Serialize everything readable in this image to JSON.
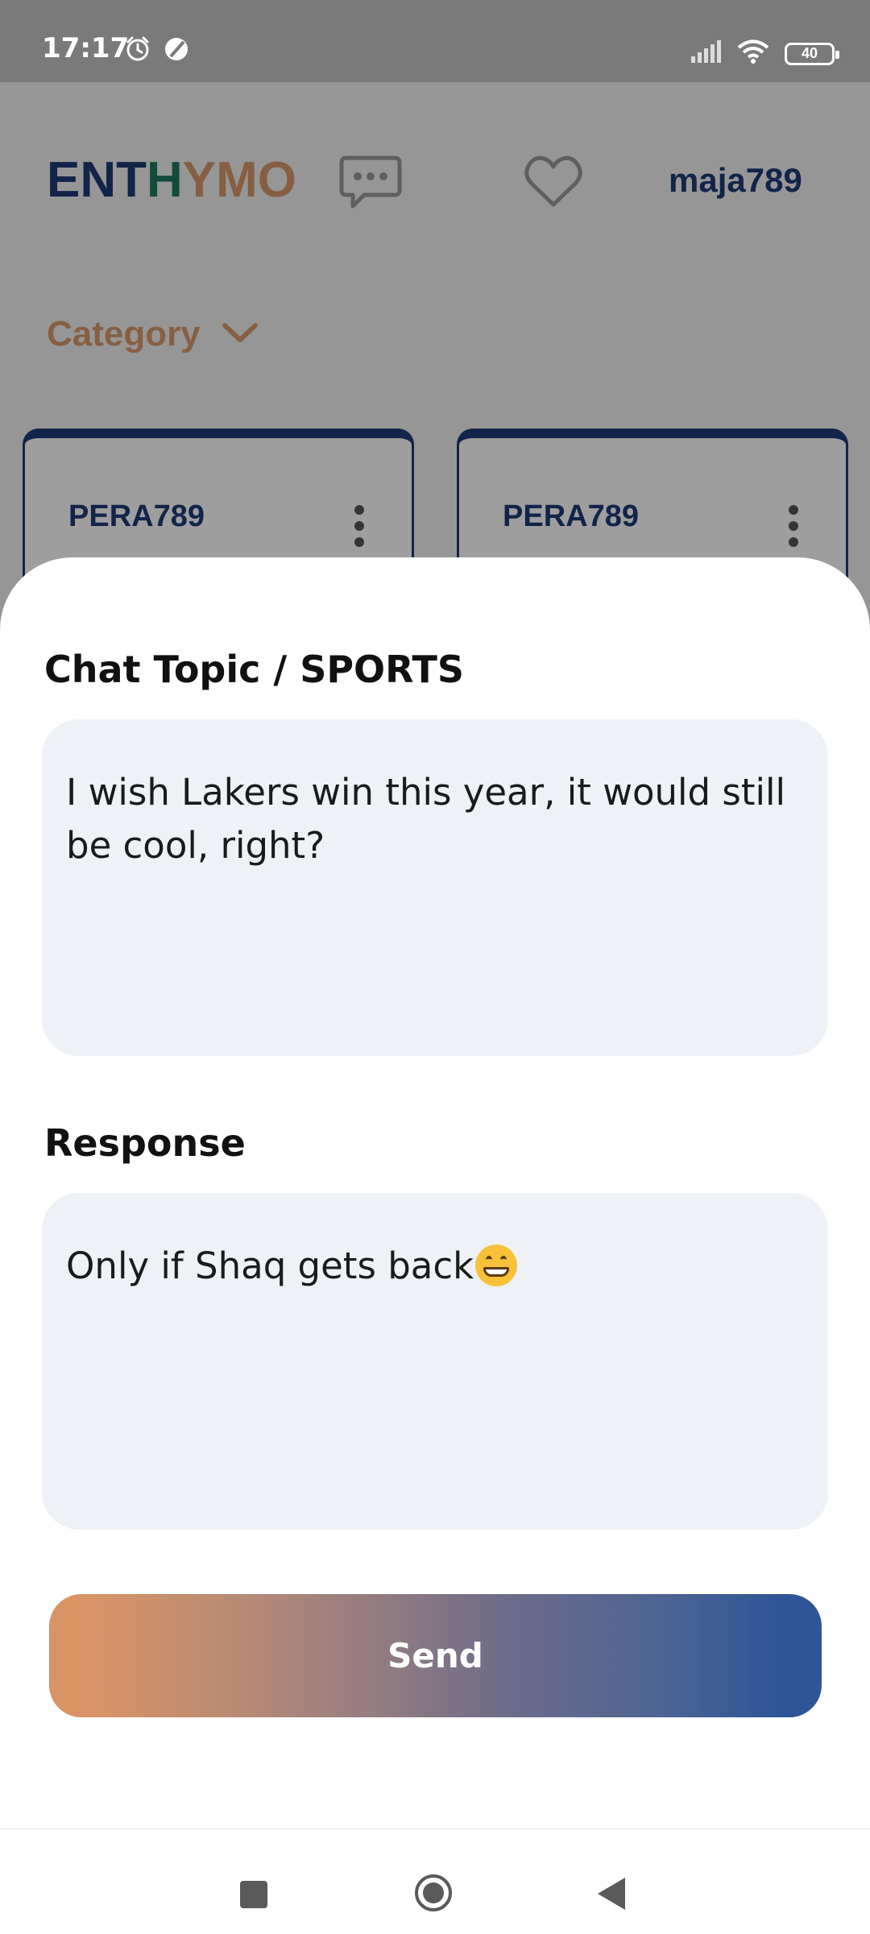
{
  "status_bar": {
    "time": "17:17",
    "battery": "40",
    "icons": [
      "alarm-icon",
      "moon-icon",
      "signal-icon",
      "wifi-icon",
      "battery-icon"
    ]
  },
  "header": {
    "logo_part1": "ENT",
    "logo_part2": "H",
    "logo_part3": "YMO",
    "username": "maja789",
    "icons": [
      "chat-bubble-icon",
      "heart-icon"
    ]
  },
  "filter": {
    "category_label": "Category"
  },
  "posts": [
    {
      "user": "PERA789"
    },
    {
      "user": "PERA789"
    }
  ],
  "sheet": {
    "topic_heading": "Chat Topic / SPORTS",
    "topic_text": "I wish Lakers win this year, it would still be cool, right?",
    "response_heading": "Response",
    "response_text": "Only if Shaq gets back",
    "response_emoji": "grinning-face-emoji",
    "send_label": "Send"
  },
  "colors": {
    "brand_navy": "#1d3a76",
    "brand_green": "#1f7a63",
    "brand_orange": "#d99a6b",
    "button_gradient_start": "#d99466",
    "button_gradient_end": "#2e5597",
    "field_background": "#eef1f5"
  },
  "nav_bar": {
    "icons": [
      "recent-apps-icon",
      "home-icon",
      "back-icon"
    ]
  }
}
